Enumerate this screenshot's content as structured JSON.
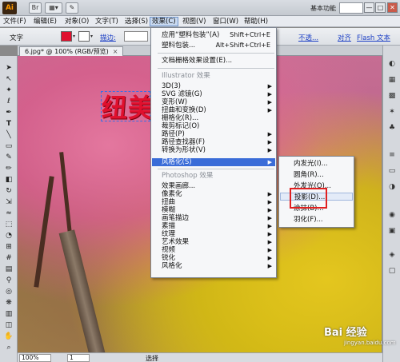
{
  "app": {
    "logo": "Ai",
    "workspace": "基本功能",
    "window_controls": [
      "—",
      "□",
      "✕"
    ]
  },
  "menubar": [
    "文件(F)",
    "编辑(E)",
    "对象(O)",
    "文字(T)",
    "选择(S)",
    "效果(C)",
    "视图(V)",
    "窗口(W)",
    "帮助(H)"
  ],
  "controlbar": {
    "label": "文字",
    "fill_color": "#e0102e",
    "stroke_label": "描边:",
    "opacity_label": "不透...",
    "align_label": "对齐",
    "flash_label": "Flash 文本"
  },
  "document_tab": {
    "title": "6.jpg* @ 100% (RGB/预览)",
    "close": "×"
  },
  "canvas": {
    "headline": "纽美"
  },
  "effect_menu": {
    "items": [
      {
        "label": "应用“塑料包装”(A)",
        "shortcut": "Shift+Ctrl+E"
      },
      {
        "label": "塑料包装...",
        "shortcut": "Alt+Shift+Ctrl+E"
      },
      {
        "label": "文档栅格效果设置(E)..."
      },
      {
        "label": "Illustrator 效果",
        "header": true
      },
      {
        "label": "3D(3)",
        "submenu": true
      },
      {
        "label": "SVG 滤镜(G)",
        "submenu": true
      },
      {
        "label": "变形(W)",
        "submenu": true
      },
      {
        "label": "扭曲和变换(D)",
        "submenu": true
      },
      {
        "label": "栅格化(R)..."
      },
      {
        "label": "裁剪标记(O)"
      },
      {
        "label": "路径(P)",
        "submenu": true
      },
      {
        "label": "路径查找器(F)",
        "submenu": true
      },
      {
        "label": "转换为形状(V)",
        "submenu": true
      },
      {
        "label": "风格化(S)",
        "submenu": true,
        "highlighted": true
      },
      {
        "label": "Photoshop 效果",
        "header": true
      },
      {
        "label": "效果画廊..."
      },
      {
        "label": "像素化",
        "submenu": true
      },
      {
        "label": "扭曲",
        "submenu": true
      },
      {
        "label": "模糊",
        "submenu": true
      },
      {
        "label": "画笔描边",
        "submenu": true
      },
      {
        "label": "素描",
        "submenu": true
      },
      {
        "label": "纹理",
        "submenu": true
      },
      {
        "label": "艺术效果",
        "submenu": true
      },
      {
        "label": "视频",
        "submenu": true
      },
      {
        "label": "锐化",
        "submenu": true
      },
      {
        "label": "风格化",
        "submenu": true
      }
    ]
  },
  "stylize_submenu": {
    "items": [
      "内发光(I)...",
      "圆角(R)...",
      "外发光(O)...",
      "投影(D)...",
      "涂抹(B)...",
      "羽化(F)..."
    ]
  },
  "statusbar": {
    "zoom": "100%",
    "page": "1",
    "status": "选择"
  },
  "watermark": {
    "brand": "Bai 经验",
    "url": "jingyan.baidu.com"
  }
}
